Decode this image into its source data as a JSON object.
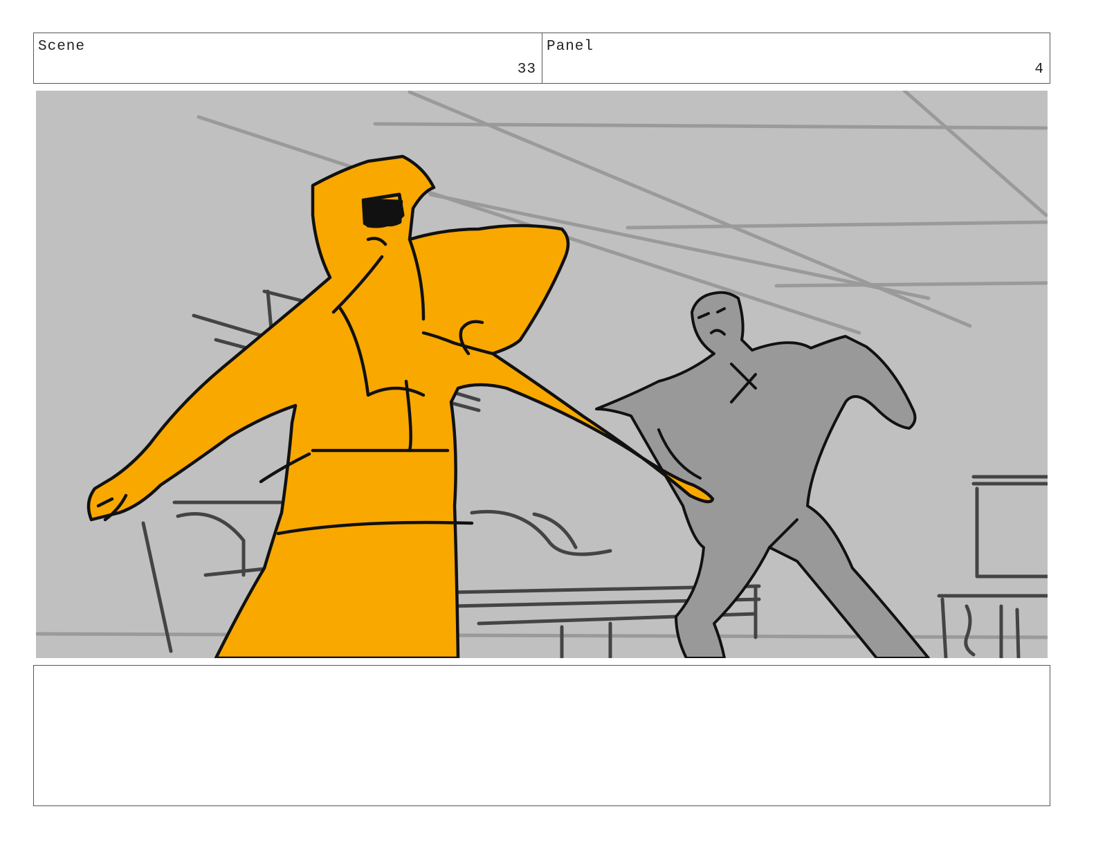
{
  "header": {
    "scene_label": "Scene",
    "scene_number": "33",
    "panel_label": "Panel",
    "panel_number": "4"
  },
  "colors": {
    "background": "#c0c0c0",
    "foreground_figure": "#f9a800",
    "background_figure": "#999999",
    "lines": "#111111"
  },
  "notes": {
    "text": ""
  }
}
